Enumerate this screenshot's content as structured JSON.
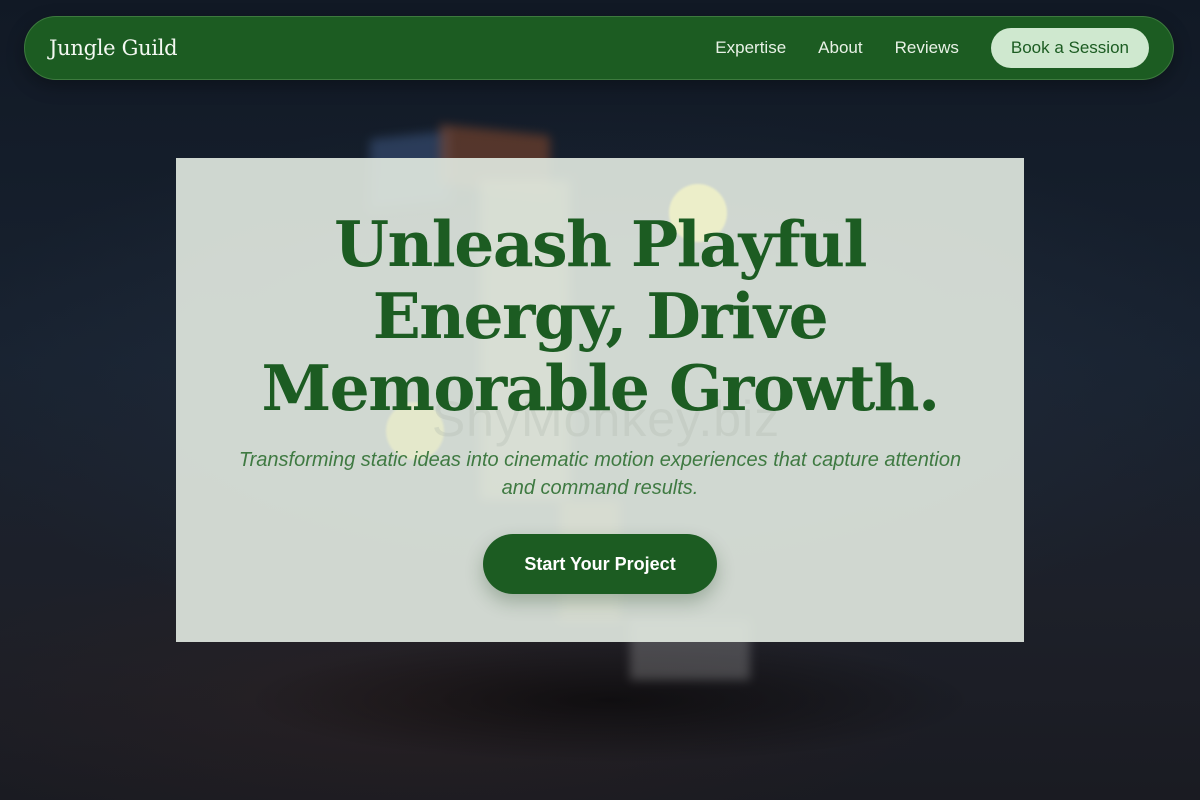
{
  "header": {
    "brand": "Jungle Guild",
    "nav": [
      {
        "label": "Expertise"
      },
      {
        "label": "About"
      },
      {
        "label": "Reviews"
      }
    ],
    "cta_label": "Book a Session"
  },
  "hero": {
    "headline": "Unleash Playful Energy, Drive Memorable Growth.",
    "subtitle": "Transforming static ideas into cinematic motion experiences that capture attention and command results.",
    "cta_label": "Start Your Project",
    "watermark": "ShyMonkey.biz"
  },
  "colors": {
    "brand_green": "#1c5c22",
    "nav_button_bg": "#cfe8cf",
    "hero_panel_bg": "#e0e7de",
    "subtitle_green": "#3f7a42",
    "page_bg": "#131a25"
  }
}
